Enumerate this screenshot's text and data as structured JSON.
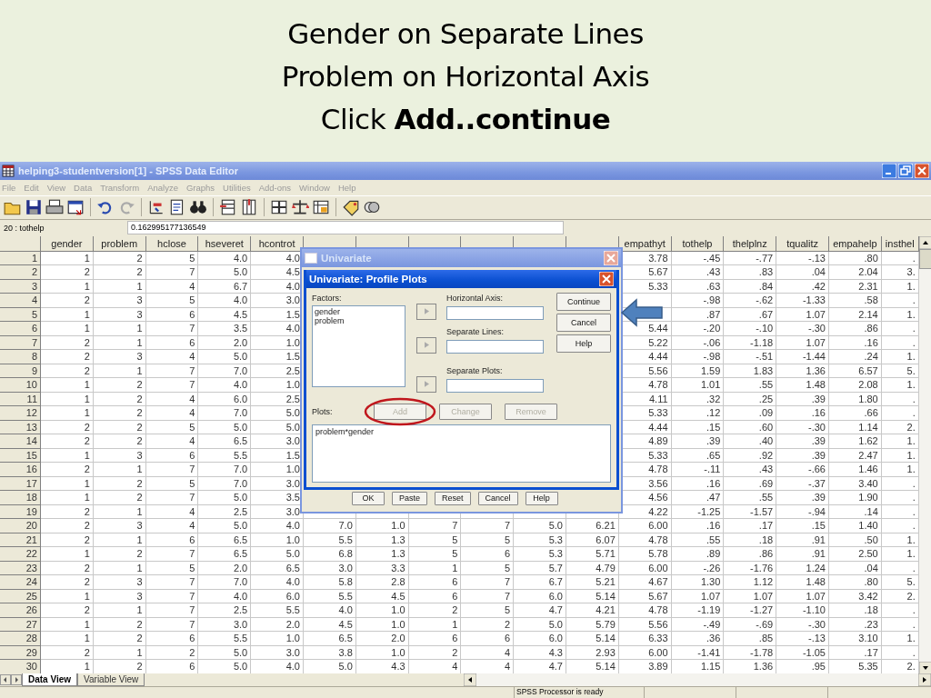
{
  "slide": {
    "title_lines": [
      "Gender on Separate Lines",
      "Problem on Horizontal Axis",
      "Click **Add..continue**"
    ]
  },
  "window": {
    "title": "helping3-studentversion[1] - SPSS Data Editor"
  },
  "menu": [
    "File",
    "Edit",
    "View",
    "Data",
    "Transform",
    "Analyze",
    "Graphs",
    "Utilities",
    "Add-ons",
    "Window",
    "Help"
  ],
  "cell_editor": {
    "cell": "20 : tothelp",
    "value": "0.162995177136549"
  },
  "table": {
    "columns": [
      "gender",
      "problem",
      "hclose",
      "hseveret",
      "hcontrot",
      null,
      null,
      null,
      null,
      null,
      null,
      "empathyt",
      "tothelp",
      "thelplnz",
      "tqualitz",
      "empahelp",
      "insthel"
    ],
    "rows": [
      {
        "number": "1",
        "cells": [
          "1",
          "2",
          "5",
          "4.0",
          "4.0",
          null,
          null,
          null,
          null,
          null,
          null,
          "3.78",
          "-.45",
          "-.77",
          "-.13",
          ".80",
          "."
        ]
      },
      {
        "number": "2",
        "cells": [
          "2",
          "2",
          "7",
          "5.0",
          "4.5",
          null,
          null,
          null,
          null,
          null,
          null,
          "5.67",
          ".43",
          ".83",
          ".04",
          "2.04",
          "3."
        ]
      },
      {
        "number": "3",
        "cells": [
          "1",
          "1",
          "4",
          "6.7",
          "4.0",
          null,
          null,
          null,
          null,
          null,
          null,
          "5.33",
          ".63",
          ".84",
          ".42",
          "2.31",
          "1."
        ]
      },
      {
        "number": "4",
        "cells": [
          "2",
          "3",
          "5",
          "4.0",
          "3.0",
          null,
          null,
          null,
          null,
          null,
          null,
          null,
          "-.98",
          "-.62",
          "-1.33",
          ".58",
          "."
        ]
      },
      {
        "number": "5",
        "cells": [
          "1",
          "3",
          "6",
          "4.5",
          "1.5",
          null,
          null,
          null,
          null,
          null,
          null,
          null,
          ".87",
          ".67",
          "1.07",
          "2.14",
          "1."
        ]
      },
      {
        "number": "6",
        "cells": [
          "1",
          "1",
          "7",
          "3.5",
          "4.0",
          null,
          null,
          null,
          null,
          null,
          null,
          "5.44",
          "-.20",
          "-.10",
          "-.30",
          ".86",
          "."
        ]
      },
      {
        "number": "7",
        "cells": [
          "2",
          "1",
          "6",
          "2.0",
          "1.0",
          null,
          null,
          null,
          null,
          null,
          null,
          "5.22",
          "-.06",
          "-1.18",
          "1.07",
          ".16",
          "."
        ]
      },
      {
        "number": "8",
        "cells": [
          "2",
          "3",
          "4",
          "5.0",
          "1.5",
          null,
          null,
          null,
          null,
          null,
          null,
          "4.44",
          "-.98",
          "-.51",
          "-1.44",
          ".24",
          "1."
        ]
      },
      {
        "number": "9",
        "cells": [
          "2",
          "1",
          "7",
          "7.0",
          "2.5",
          null,
          null,
          null,
          null,
          null,
          null,
          "5.56",
          "1.59",
          "1.83",
          "1.36",
          "6.57",
          "5."
        ]
      },
      {
        "number": "10",
        "cells": [
          "1",
          "2",
          "7",
          "4.0",
          "1.0",
          null,
          null,
          null,
          null,
          null,
          null,
          "4.78",
          "1.01",
          ".55",
          "1.48",
          "2.08",
          "1."
        ]
      },
      {
        "number": "11",
        "cells": [
          "1",
          "2",
          "4",
          "6.0",
          "2.5",
          null,
          null,
          null,
          null,
          null,
          null,
          "4.11",
          ".32",
          ".25",
          ".39",
          "1.80",
          "."
        ]
      },
      {
        "number": "12",
        "cells": [
          "1",
          "2",
          "4",
          "7.0",
          "5.0",
          null,
          null,
          null,
          null,
          null,
          null,
          "5.33",
          ".12",
          ".09",
          ".16",
          ".66",
          "."
        ]
      },
      {
        "number": "13",
        "cells": [
          "2",
          "2",
          "5",
          "5.0",
          "5.0",
          null,
          null,
          null,
          null,
          null,
          null,
          "4.44",
          ".15",
          ".60",
          "-.30",
          "1.14",
          "2."
        ]
      },
      {
        "number": "14",
        "cells": [
          "2",
          "2",
          "4",
          "6.5",
          "3.0",
          null,
          null,
          null,
          null,
          null,
          null,
          "4.89",
          ".39",
          ".40",
          ".39",
          "1.62",
          "1."
        ]
      },
      {
        "number": "15",
        "cells": [
          "1",
          "3",
          "6",
          "5.5",
          "1.5",
          null,
          null,
          null,
          null,
          null,
          null,
          "5.33",
          ".65",
          ".92",
          ".39",
          "2.47",
          "1."
        ]
      },
      {
        "number": "16",
        "cells": [
          "2",
          "1",
          "7",
          "7.0",
          "1.0",
          null,
          null,
          null,
          null,
          null,
          null,
          "4.78",
          "-.11",
          ".43",
          "-.66",
          "1.46",
          "1."
        ]
      },
      {
        "number": "17",
        "cells": [
          "1",
          "2",
          "5",
          "7.0",
          "3.0",
          null,
          null,
          null,
          null,
          null,
          null,
          "3.56",
          ".16",
          ".69",
          "-.37",
          "3.40",
          "."
        ]
      },
      {
        "number": "18",
        "cells": [
          "1",
          "2",
          "7",
          "5.0",
          "3.5",
          null,
          null,
          null,
          null,
          null,
          null,
          "4.56",
          ".47",
          ".55",
          ".39",
          "1.90",
          "."
        ]
      },
      {
        "number": "19",
        "cells": [
          "2",
          "1",
          "4",
          "2.5",
          "3.0",
          null,
          null,
          null,
          null,
          null,
          null,
          "4.22",
          "-1.25",
          "-1.57",
          "-.94",
          ".14",
          "."
        ]
      },
      {
        "number": "20",
        "cells": [
          "2",
          "3",
          "4",
          "5.0",
          "4.0",
          "7.0",
          "1.0",
          "7",
          "7",
          "5.0",
          "6.21",
          "6.00",
          ".16",
          ".17",
          ".15",
          "1.40",
          "."
        ]
      },
      {
        "number": "21",
        "cells": [
          "2",
          "1",
          "6",
          "6.5",
          "1.0",
          "5.5",
          "1.3",
          "5",
          "5",
          "5.3",
          "6.07",
          "4.78",
          ".55",
          ".18",
          ".91",
          ".50",
          "1."
        ]
      },
      {
        "number": "22",
        "cells": [
          "1",
          "2",
          "7",
          "6.5",
          "5.0",
          "6.8",
          "1.3",
          "5",
          "6",
          "5.3",
          "5.71",
          "5.78",
          ".89",
          ".86",
          ".91",
          "2.50",
          "1."
        ]
      },
      {
        "number": "23",
        "cells": [
          "2",
          "1",
          "5",
          "2.0",
          "6.5",
          "3.0",
          "3.3",
          "1",
          "5",
          "5.7",
          "4.79",
          "6.00",
          "-.26",
          "-1.76",
          "1.24",
          ".04",
          "."
        ]
      },
      {
        "number": "24",
        "cells": [
          "2",
          "3",
          "7",
          "7.0",
          "4.0",
          "5.8",
          "2.8",
          "6",
          "7",
          "6.7",
          "5.21",
          "4.67",
          "1.30",
          "1.12",
          "1.48",
          ".80",
          "5."
        ]
      },
      {
        "number": "25",
        "cells": [
          "1",
          "3",
          "7",
          "4.0",
          "6.0",
          "5.5",
          "4.5",
          "6",
          "7",
          "6.0",
          "5.14",
          "5.67",
          "1.07",
          "1.07",
          "1.07",
          "3.42",
          "2."
        ]
      },
      {
        "number": "26",
        "cells": [
          "2",
          "1",
          "7",
          "2.5",
          "5.5",
          "4.0",
          "1.0",
          "2",
          "5",
          "4.7",
          "4.21",
          "4.78",
          "-1.19",
          "-1.27",
          "-1.10",
          ".18",
          "."
        ]
      },
      {
        "number": "27",
        "cells": [
          "1",
          "2",
          "7",
          "3.0",
          "2.0",
          "4.5",
          "1.0",
          "1",
          "2",
          "5.0",
          "5.79",
          "5.56",
          "-.49",
          "-.69",
          "-.30",
          ".23",
          "."
        ]
      },
      {
        "number": "28",
        "cells": [
          "1",
          "2",
          "6",
          "5.5",
          "1.0",
          "6.5",
          "2.0",
          "6",
          "6",
          "6.0",
          "5.14",
          "6.33",
          ".36",
          ".85",
          "-.13",
          "3.10",
          "1."
        ]
      },
      {
        "number": "29",
        "cells": [
          "2",
          "1",
          "2",
          "5.0",
          "3.0",
          "3.8",
          "1.0",
          "2",
          "4",
          "4.3",
          "2.93",
          "6.00",
          "-1.41",
          "-1.78",
          "-1.05",
          ".17",
          "."
        ]
      },
      {
        "number": "30",
        "cells": [
          "1",
          "2",
          "6",
          "5.0",
          "4.0",
          "5.0",
          "4.3",
          "4",
          "4",
          "4.7",
          "5.14",
          "3.89",
          "1.15",
          "1.36",
          ".95",
          "5.35",
          "2."
        ]
      }
    ]
  },
  "dialog": {
    "title": "Univariate",
    "buttons": [
      "OK",
      "Paste",
      "Reset",
      "Cancel",
      "Help"
    ],
    "subdialog": {
      "title": "Univariate: Profile Plots",
      "factors_label": "Factors:",
      "factors": [
        "gender",
        "problem"
      ],
      "targets": [
        {
          "label": "Horizontal Axis:"
        },
        {
          "label": "Separate Lines:"
        },
        {
          "label": "Separate Plots:"
        }
      ],
      "side_buttons": [
        "Continue",
        "Cancel",
        "Help"
      ],
      "plots_label": "Plots:",
      "plot_buttons": [
        {
          "label": "Add",
          "disabled": true,
          "highlighted": true
        },
        {
          "label": "Change",
          "disabled": true,
          "highlighted": false
        },
        {
          "label": "Remove",
          "disabled": true,
          "highlighted": false
        }
      ],
      "plots": [
        "problem*gender"
      ]
    }
  },
  "tabs": [
    {
      "label": "Data View",
      "selected": true
    },
    {
      "label": "Variable View",
      "selected": false
    }
  ],
  "status_bar": {
    "text": "SPSS Processor  is ready"
  }
}
